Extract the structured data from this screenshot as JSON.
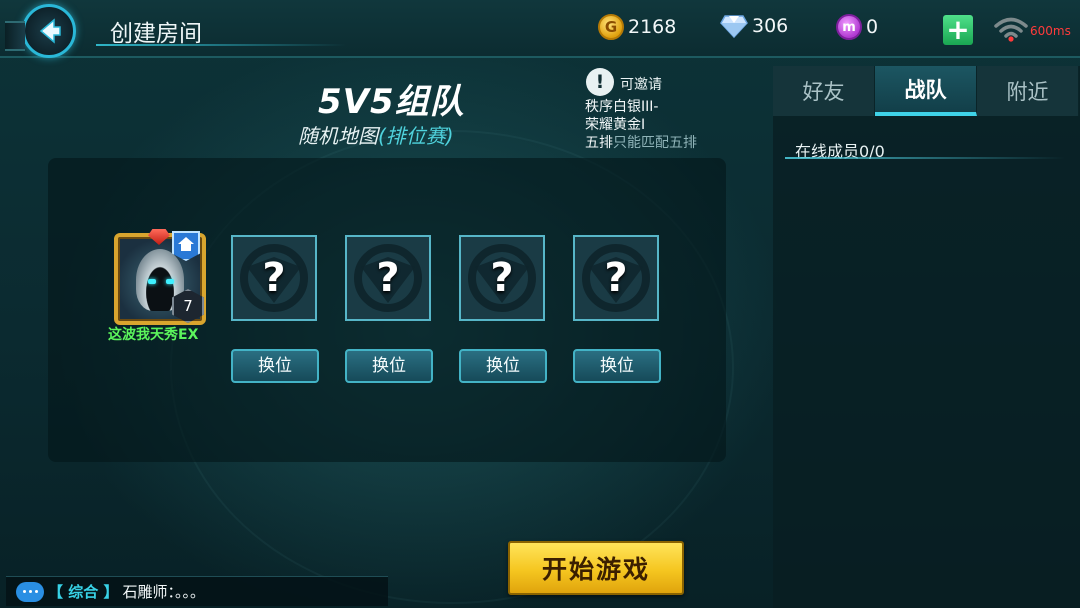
{
  "header": {
    "title": "创建房间",
    "gold": "2168",
    "gold_symbol": "G",
    "diamonds": "306",
    "tokens": "0",
    "token_symbol": "m",
    "ping": "600ms"
  },
  "room": {
    "mode_title": "5V5组队",
    "map_name": "随机地图",
    "match_type": "(排位赛)",
    "invite_label": "可邀请",
    "invite_rank_1": "秩序白银III-",
    "invite_rank_2": "荣耀黄金I",
    "five_stack_prefix": "五排",
    "five_stack_note": "只能匹配五排"
  },
  "team": {
    "player_name": "这波我天秀EX",
    "player_level": "7",
    "empty_slot_symbol": "?",
    "swap_label": "换位"
  },
  "side_panel": {
    "tabs": [
      {
        "label": "好友",
        "active": false
      },
      {
        "label": "战队",
        "active": true
      },
      {
        "label": "附近",
        "active": false
      }
    ],
    "online_members": "在线成员0/0"
  },
  "start_button": "开始游戏",
  "chat": {
    "channel": "【 综合 】",
    "message": "石雕师：。。。"
  },
  "colors": {
    "accent": "#3fd3e8",
    "player_name": "#5cf55c",
    "ping": "#ff3b3b",
    "start_button": "#f5c620"
  },
  "icons": {
    "back": "back-arrow-icon",
    "gold": "gold-coin-icon",
    "diamond": "diamond-icon",
    "token": "token-icon",
    "add": "plus-icon",
    "wifi": "wifi-icon",
    "invite": "exclamation-icon",
    "chat": "chat-bubble-icon"
  }
}
